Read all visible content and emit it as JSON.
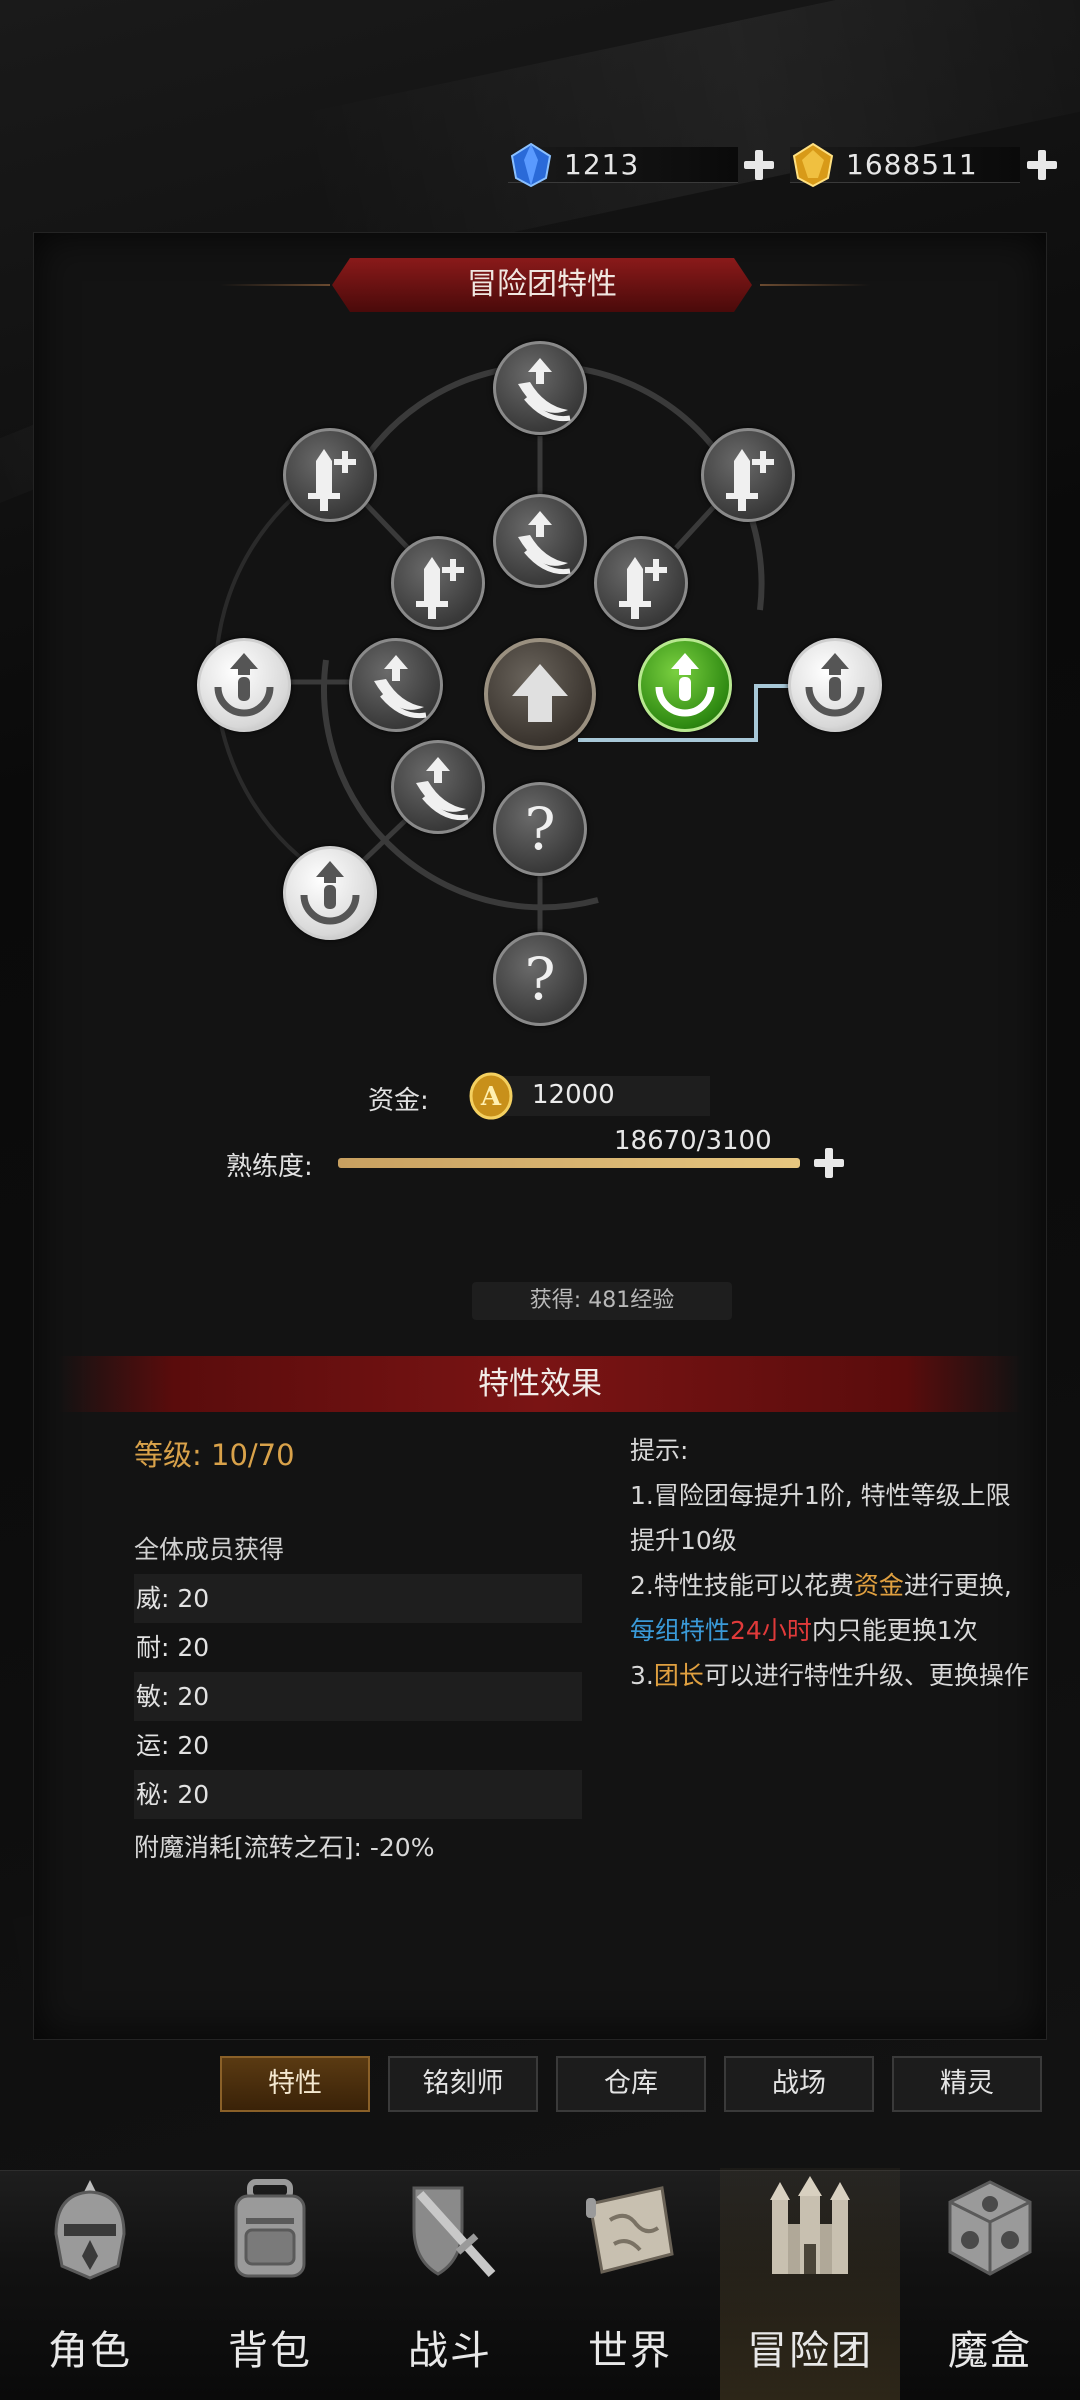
{
  "currency": {
    "gems": {
      "icon": "blue-crystal-icon",
      "value": "1213"
    },
    "gold": {
      "icon": "gold-crystal-icon",
      "value": "1688511"
    }
  },
  "panel": {
    "title": "冒险团特性"
  },
  "tree": {
    "center_icon": "arrow-up-icon",
    "nodes": [
      {
        "name": "skill-node-top",
        "icon": "claw-upgrade-icon",
        "style": "gray"
      },
      {
        "name": "skill-node-upper-left",
        "icon": "sword-plus-icon",
        "style": "gray"
      },
      {
        "name": "skill-node-upper-right",
        "icon": "sword-plus-icon",
        "style": "gray"
      },
      {
        "name": "skill-node-inner-top",
        "icon": "claw-upgrade-icon",
        "style": "gray"
      },
      {
        "name": "skill-node-inner-upper-left",
        "icon": "sword-plus-icon",
        "style": "gray"
      },
      {
        "name": "skill-node-inner-upper-right",
        "icon": "sword-plus-icon",
        "style": "gray"
      },
      {
        "name": "skill-node-left",
        "icon": "emblem-upgrade-icon",
        "style": "white"
      },
      {
        "name": "skill-node-inner-left",
        "icon": "claw-upgrade-icon",
        "style": "gray"
      },
      {
        "name": "skill-node-inner-right",
        "icon": "emblem-upgrade-icon",
        "style": "green"
      },
      {
        "name": "skill-node-right",
        "icon": "emblem-upgrade-icon",
        "style": "white"
      },
      {
        "name": "skill-node-inner-lower-left",
        "icon": "claw-upgrade-icon",
        "style": "gray"
      },
      {
        "name": "skill-node-inner-bottom",
        "icon": "question-mark-icon",
        "style": "gray"
      },
      {
        "name": "skill-node-lower-left",
        "icon": "emblem-upgrade-icon",
        "style": "white"
      },
      {
        "name": "skill-node-bottom",
        "icon": "question-mark-icon",
        "style": "gray"
      }
    ]
  },
  "funds": {
    "label": "资金:",
    "value": "12000",
    "icon": "adventure-coin-icon"
  },
  "proficiency": {
    "label": "熟练度:",
    "text": "18670/3100",
    "progress": 1.0
  },
  "gain": {
    "text": "获得: 481经验"
  },
  "effects": {
    "title": "特性效果",
    "level": "等级:  10/70",
    "members_title": "全体成员获得",
    "stats": [
      "威: 20",
      "耐: 20",
      "敏: 20",
      "运: 20",
      "秘: 20"
    ],
    "enchant": "附魔消耗[流转之石]: -20%",
    "tips": {
      "title": "提示:",
      "line1": "1.冒险团每提升1阶, 特性等级上限提升10级",
      "line2_a": "2.特性技能可以花费",
      "line2_b": "资金",
      "line2_c": "进行更换, ",
      "line2_d": "每组特性",
      "line2_e": "24小时",
      "line2_f": "内只能更换1次",
      "line3_a": "3.",
      "line3_b": "团长",
      "line3_c": "可以进行特性升级、更换操作"
    }
  },
  "subtabs": [
    "特性",
    "铭刻师",
    "仓库",
    "战场",
    "精灵"
  ],
  "nav": [
    {
      "label": "角色",
      "icon": "helmet-icon"
    },
    {
      "label": "背包",
      "icon": "backpack-icon"
    },
    {
      "label": "战斗",
      "icon": "sword-shield-icon"
    },
    {
      "label": "世界",
      "icon": "map-scroll-icon"
    },
    {
      "label": "冒险团",
      "icon": "castle-icon"
    },
    {
      "label": "魔盒",
      "icon": "magic-cube-icon"
    }
  ],
  "colors": {
    "accent_gold": "#e0a040",
    "active_green": "#2f8a12",
    "banner_red": "#7a1414",
    "tip_blue": "#3a9ad8",
    "tip_red": "#e03a3a"
  }
}
